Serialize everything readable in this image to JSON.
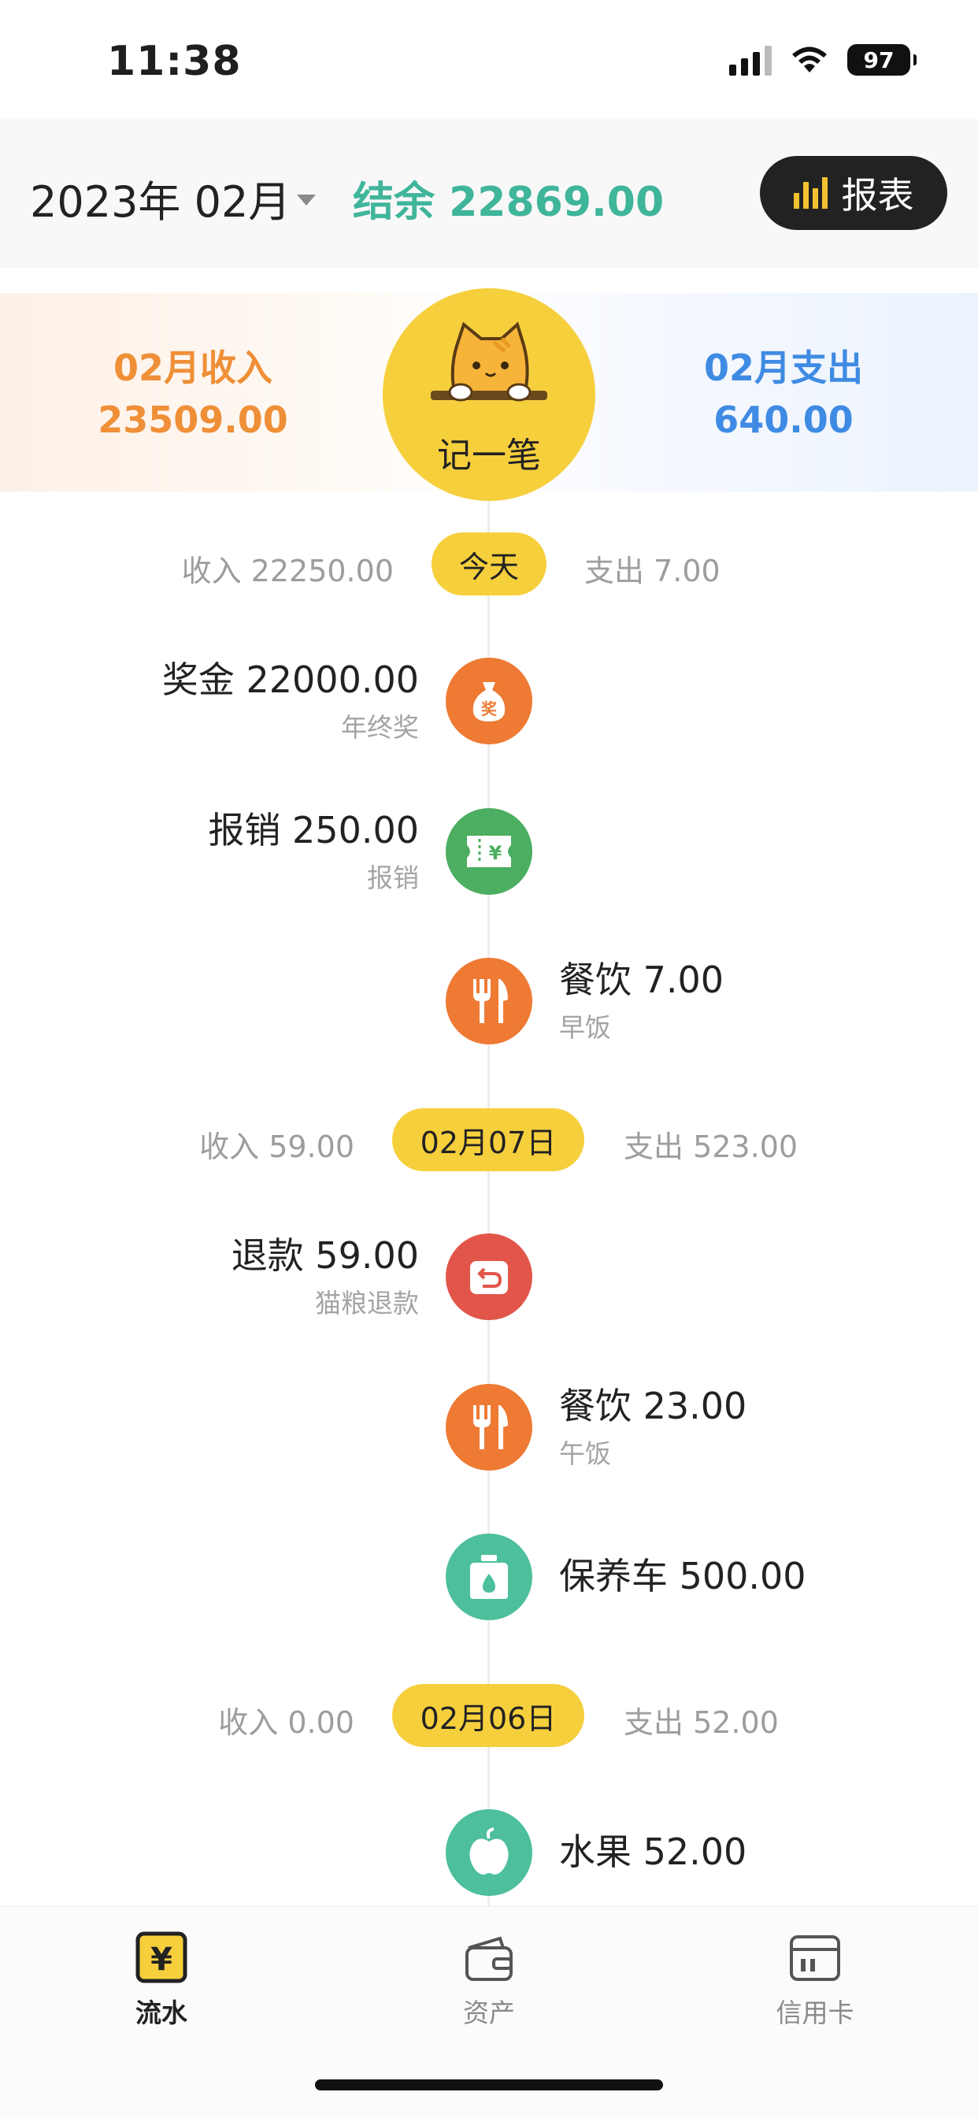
{
  "status_bar": {
    "time": "11:38",
    "battery": "97"
  },
  "header": {
    "month": "2023年 02月",
    "balance_label": "结余",
    "balance_value": "22869.00",
    "report_label": "报表"
  },
  "summary": {
    "income_label": "02月收入",
    "income_value": "23509.00",
    "expense_label": "02月支出",
    "expense_value": "640.00",
    "add_label": "记一笔"
  },
  "days": [
    {
      "label": "今天",
      "income": "收入 22250.00",
      "expense": "支出 7.00",
      "entries": [
        {
          "side": "left",
          "title": "奖金 22000.00",
          "note": "年终奖",
          "icon": "money-bag-icon",
          "color": "#ee7a34"
        },
        {
          "side": "left",
          "title": "报销 250.00",
          "note": "报销",
          "icon": "reimburse-ticket-icon",
          "color": "#4cae60"
        },
        {
          "side": "right",
          "title": "餐饮 7.00",
          "note": "早饭",
          "icon": "fork-knife-icon",
          "color": "#ee7a34"
        }
      ]
    },
    {
      "label": "02月07日",
      "income": "收入 59.00",
      "expense": "支出 523.00",
      "entries": [
        {
          "side": "left",
          "title": "退款 59.00",
          "note": "猫粮退款",
          "icon": "refund-icon",
          "color": "#e2564a"
        },
        {
          "side": "right",
          "title": "餐饮 23.00",
          "note": "午饭",
          "icon": "fork-knife-icon",
          "color": "#ee7a34"
        },
        {
          "side": "right",
          "title": "保养车 500.00",
          "note": "",
          "icon": "oil-can-icon",
          "color": "#4dbf9d"
        }
      ]
    },
    {
      "label": "02月06日",
      "income": "收入 0.00",
      "expense": "支出 52.00",
      "entries": [
        {
          "side": "right",
          "title": "水果 52.00",
          "note": "",
          "icon": "apple-icon",
          "color": "#4dbf9d"
        }
      ]
    }
  ],
  "tabs": [
    {
      "label": "流水",
      "icon": "yen-tab-icon",
      "active": true
    },
    {
      "label": "资产",
      "icon": "wallet-icon",
      "active": false
    },
    {
      "label": "信用卡",
      "icon": "credit-card-icon",
      "active": false
    }
  ]
}
